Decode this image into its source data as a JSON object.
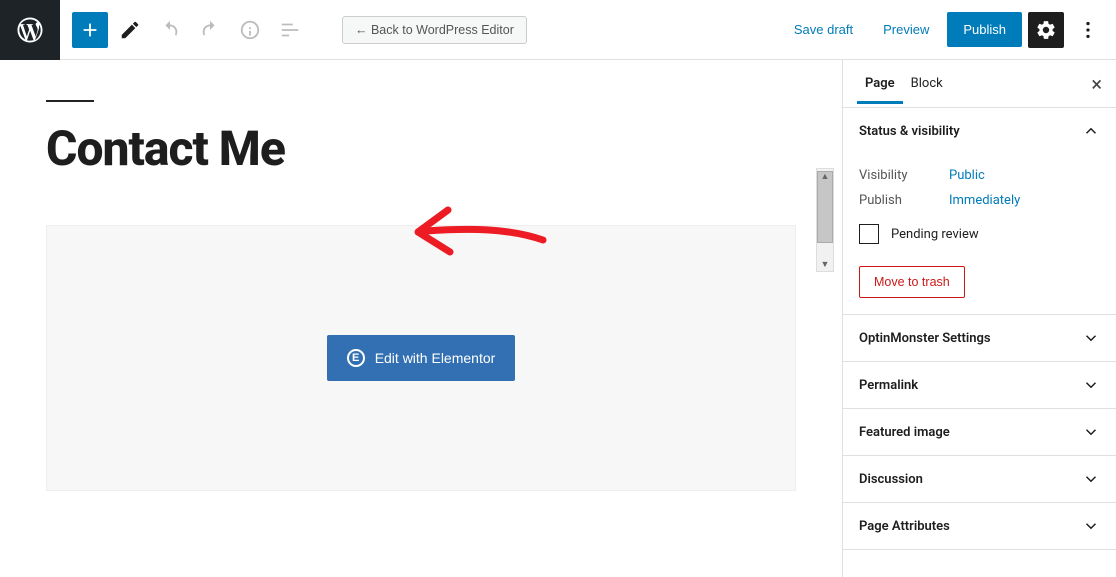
{
  "toolbar": {
    "back_label": "← Back to WordPress Editor",
    "save_draft": "Save draft",
    "preview": "Preview",
    "publish": "Publish"
  },
  "page": {
    "title": "Contact Me"
  },
  "elementor": {
    "button_label": "Edit with Elementor"
  },
  "sidebar": {
    "tabs": {
      "page": "Page",
      "block": "Block"
    },
    "status": {
      "header": "Status & visibility",
      "visibility_label": "Visibility",
      "visibility_value": "Public",
      "publish_label": "Publish",
      "publish_value": "Immediately",
      "pending_review": "Pending review",
      "trash": "Move to trash"
    },
    "panels": {
      "optinmonster": "OptinMonster Settings",
      "permalink": "Permalink",
      "featured_image": "Featured image",
      "discussion": "Discussion",
      "page_attributes": "Page Attributes"
    }
  }
}
